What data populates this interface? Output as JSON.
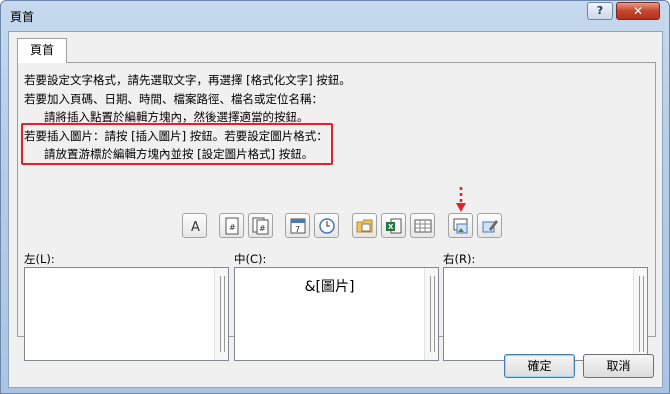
{
  "window": {
    "title": "頁首"
  },
  "titlebar": {
    "help_label": "?",
    "close_label": "✕"
  },
  "tab": {
    "label": "頁首"
  },
  "instructions": [
    "若要設定文字格式，請先選取文字，再選擇 [格式化文字] 按鈕。",
    "若要加入頁碼、日期、時間、檔案路徑、檔名或定位名稱：",
    "請將插入點置於編輯方塊內，然後選擇適當的按鈕。",
    "若要插入圖片：請按 [插入圖片] 按鈕。若要設定圖片格式：",
    "請放置游標於編輯方塊內並按 [設定圖片格式] 按鈕。"
  ],
  "toolbar": {
    "buttons": [
      {
        "icon": "format-text-icon",
        "glyph": "A"
      },
      {
        "icon": "page-number-icon"
      },
      {
        "icon": "number-of-pages-icon"
      },
      {
        "icon": "date-icon"
      },
      {
        "icon": "time-icon"
      },
      {
        "icon": "file-path-icon"
      },
      {
        "icon": "file-name-icon"
      },
      {
        "icon": "sheet-name-icon"
      },
      {
        "icon": "insert-picture-icon"
      },
      {
        "icon": "format-picture-icon"
      }
    ]
  },
  "sections": {
    "left": {
      "label": "左(L):",
      "value": ""
    },
    "center": {
      "label": "中(C):",
      "value": "&[圖片]"
    },
    "right": {
      "label": "右(R):",
      "value": ""
    }
  },
  "buttons": {
    "ok": "確定",
    "cancel": "取消"
  },
  "colors": {
    "highlight": "#e0232b",
    "arrow": "#e0232b"
  }
}
